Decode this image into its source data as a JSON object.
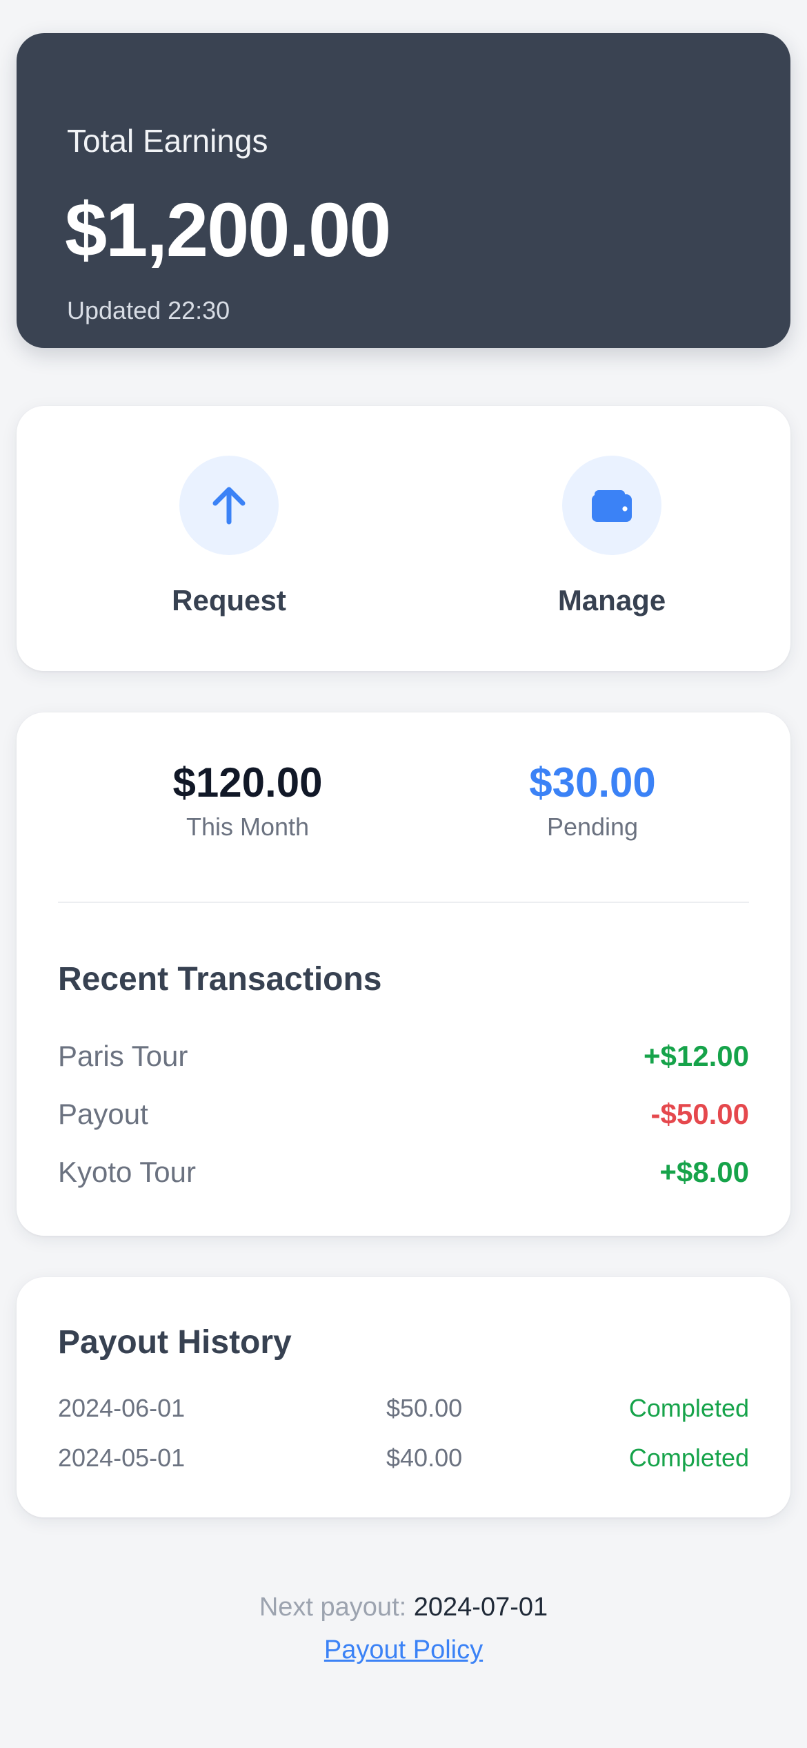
{
  "earnings": {
    "label": "Total Earnings",
    "amount": "$1,200.00",
    "updated": "Updated 22:30"
  },
  "actions": [
    {
      "label": "Request",
      "icon": "arrow-up-icon"
    },
    {
      "label": "Manage",
      "icon": "wallet-icon"
    }
  ],
  "stats": {
    "this_month": {
      "value": "$120.00",
      "caption": "This Month"
    },
    "pending": {
      "value": "$30.00",
      "caption": "Pending"
    }
  },
  "transactions": {
    "title": "Recent Transactions",
    "items": [
      {
        "name": "Paris Tour",
        "amount": "+$12.00",
        "type": "credit"
      },
      {
        "name": "Payout",
        "amount": "-$50.00",
        "type": "debit"
      },
      {
        "name": "Kyoto Tour",
        "amount": "+$8.00",
        "type": "credit"
      }
    ]
  },
  "payout_history": {
    "title": "Payout History",
    "rows": [
      {
        "date": "2024-06-01",
        "amount": "$50.00",
        "status": "Completed"
      },
      {
        "date": "2024-05-01",
        "amount": "$40.00",
        "status": "Completed"
      }
    ]
  },
  "footer": {
    "next_payout_label": "Next payout:",
    "next_payout_date": "2024-07-01",
    "policy_link": "Payout Policy"
  },
  "colors": {
    "header_bg": "#3a4352",
    "accent": "#3b82f6",
    "credit": "#16a34a",
    "debit": "#e5484d",
    "icon_bg": "#eaf2ff"
  }
}
